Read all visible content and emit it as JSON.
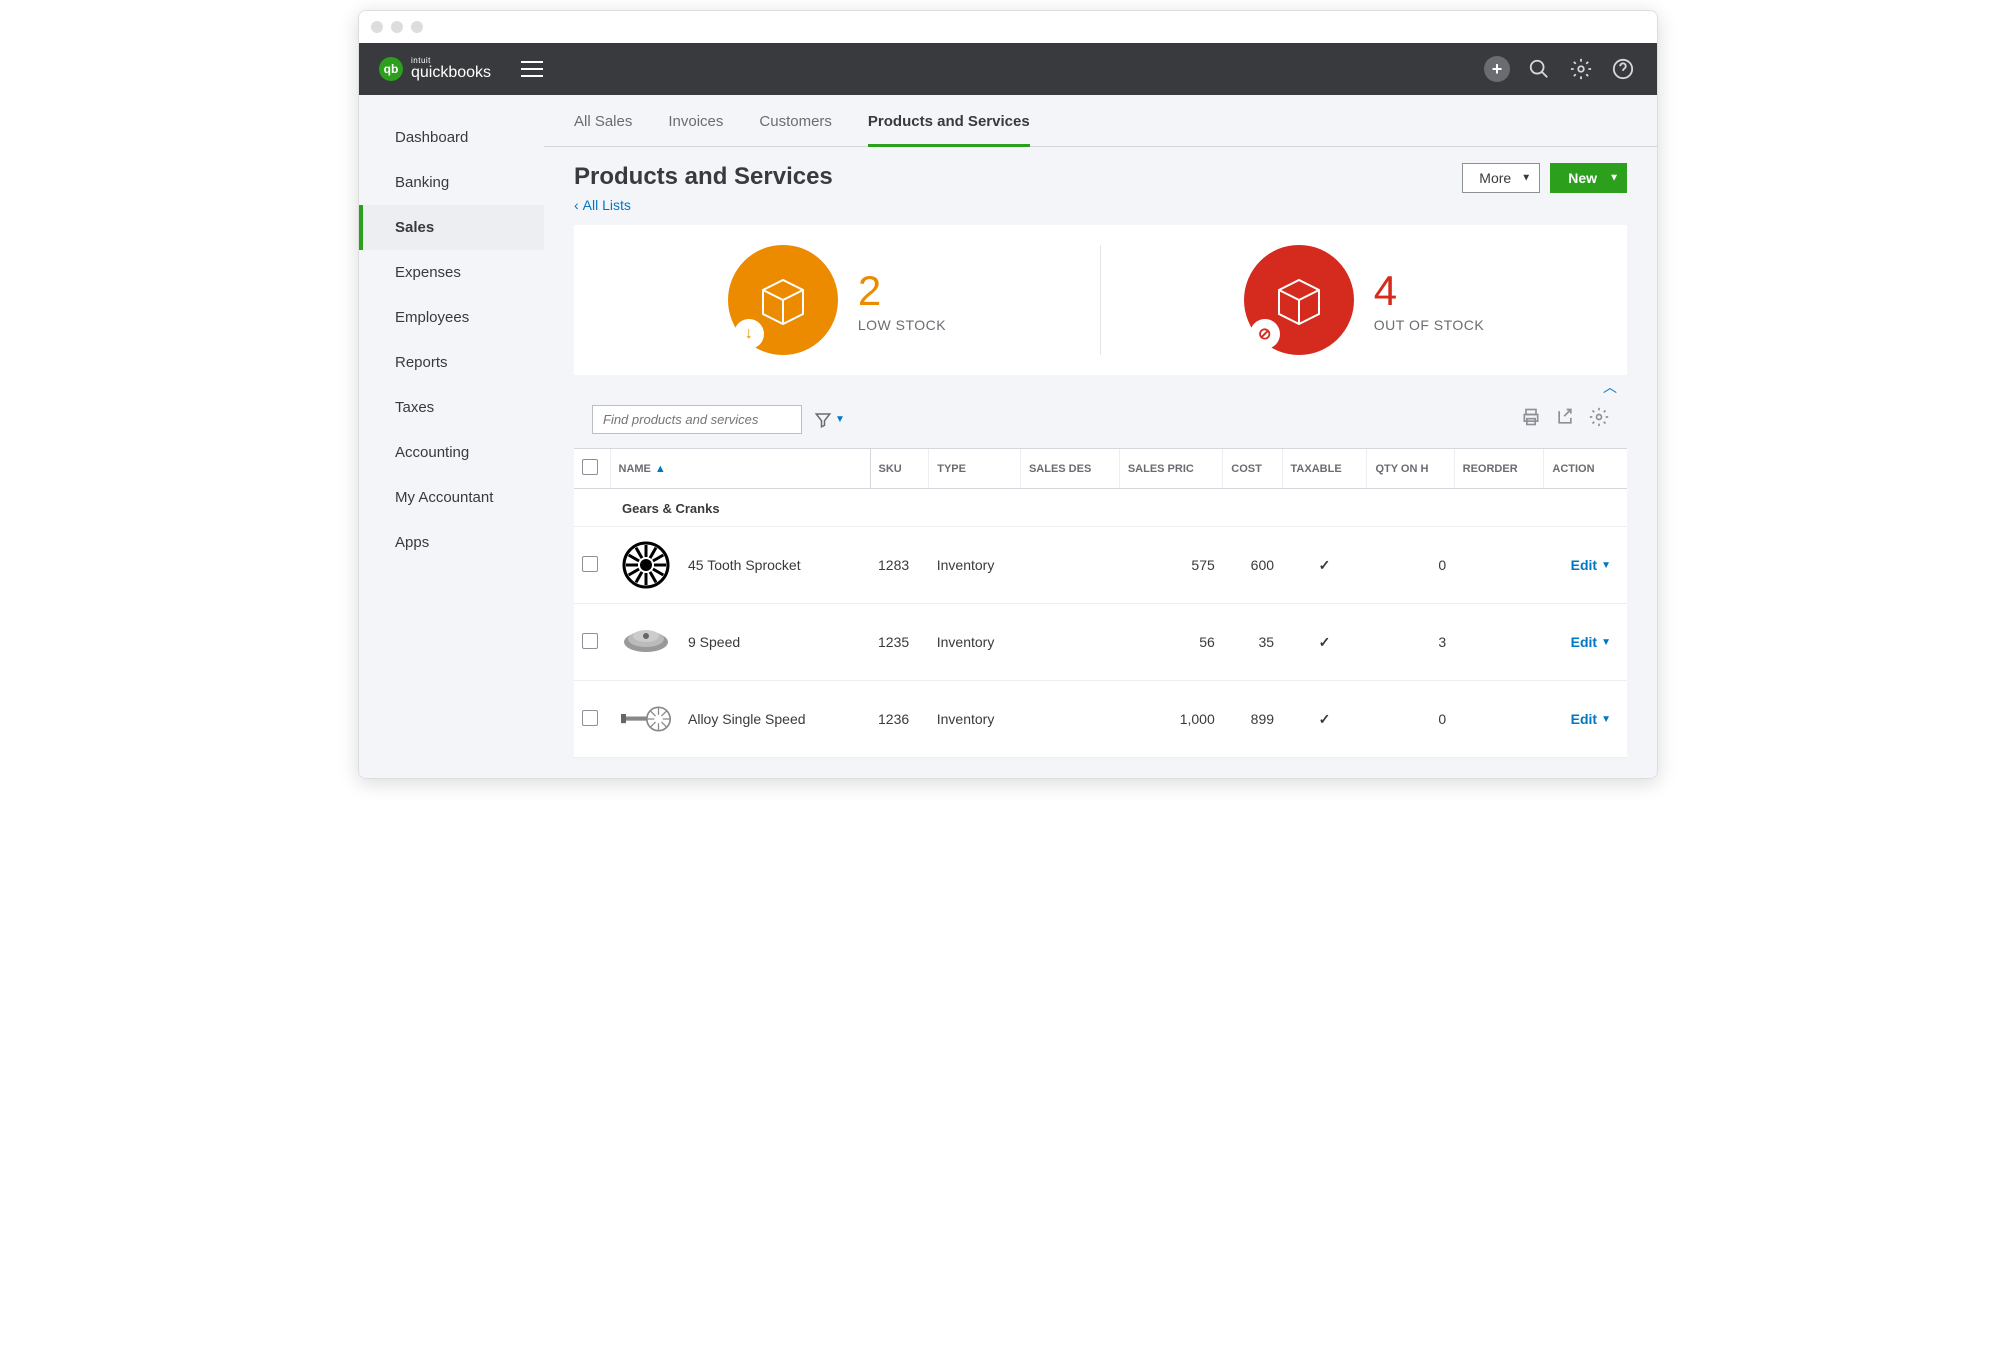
{
  "brand": {
    "intuit": "intuit",
    "name": "quickbooks"
  },
  "sidebar": {
    "items": [
      {
        "label": "Dashboard",
        "active": false
      },
      {
        "label": "Banking",
        "active": false
      },
      {
        "label": "Sales",
        "active": true
      },
      {
        "label": "Expenses",
        "active": false
      },
      {
        "label": "Employees",
        "active": false
      },
      {
        "label": "Reports",
        "active": false
      },
      {
        "label": "Taxes",
        "active": false
      },
      {
        "label": "Accounting",
        "active": false
      },
      {
        "label": "My Accountant",
        "active": false
      },
      {
        "label": "Apps",
        "active": false
      }
    ]
  },
  "tabs": [
    {
      "label": "All Sales",
      "active": false
    },
    {
      "label": "Invoices",
      "active": false
    },
    {
      "label": "Customers",
      "active": false
    },
    {
      "label": "Products and Services",
      "active": true
    }
  ],
  "page": {
    "title": "Products and Services",
    "back_link": "All Lists",
    "more_btn": "More",
    "new_btn": "New"
  },
  "stats": {
    "low": {
      "count": "2",
      "label": "LOW STOCK"
    },
    "out": {
      "count": "4",
      "label": "OUT OF STOCK"
    }
  },
  "search": {
    "placeholder": "Find products and services"
  },
  "table": {
    "headers": {
      "name": "NAME",
      "sku": "SKU",
      "type": "TYPE",
      "sales_desc": "SALES DES",
      "sales_price": "SALES PRIC",
      "cost": "COST",
      "taxable": "TAXABLE",
      "qty": "QTY ON H",
      "reorder": "REORDER",
      "action": "ACTION"
    },
    "category": "Gears & Cranks",
    "rows": [
      {
        "name": "45 Tooth Sprocket",
        "sku": "1283",
        "type": "Inventory",
        "sales_price": "575",
        "cost": "600",
        "taxable": true,
        "qty": "0",
        "action": "Edit"
      },
      {
        "name": "9 Speed",
        "sku": "1235",
        "type": "Inventory",
        "sales_price": "56",
        "cost": "35",
        "taxable": true,
        "qty": "3",
        "action": "Edit"
      },
      {
        "name": "Alloy Single Speed",
        "sku": "1236",
        "type": "Inventory",
        "sales_price": "1,000",
        "cost": "899",
        "taxable": true,
        "qty": "0",
        "action": "Edit"
      }
    ]
  }
}
